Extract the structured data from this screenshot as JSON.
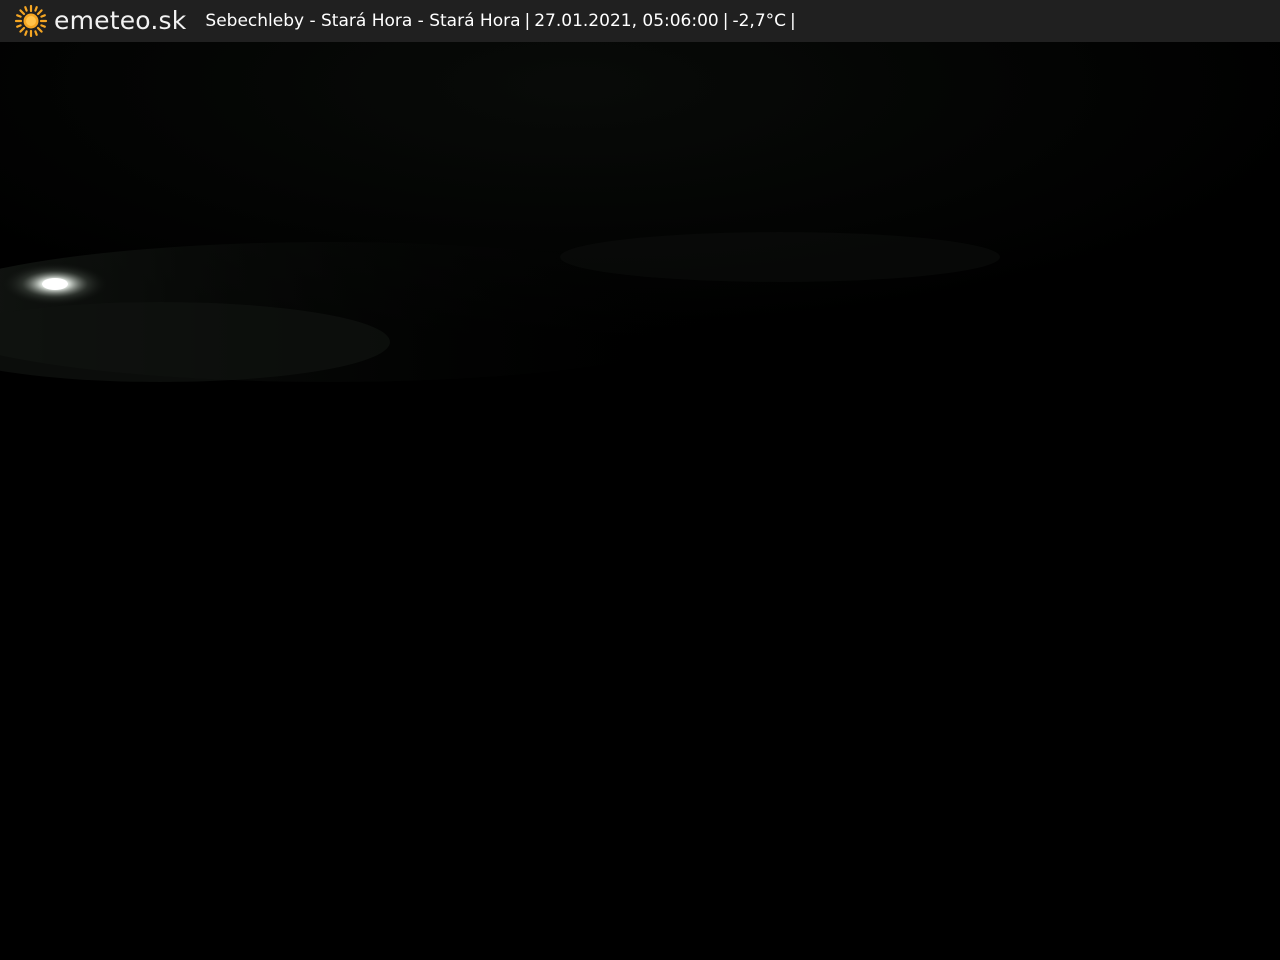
{
  "header": {
    "brand": "emeteo.sk",
    "location": "Sebechleby - Stará Hora - Stará Hora",
    "datetime": "27.01.2021, 05:06:00",
    "temperature": "-2,7°C",
    "separator": "|",
    "logo_icon": "sun-icon"
  },
  "colors": {
    "bar_background": "#202020",
    "sun": "#f5a623",
    "scene_background": "#000000"
  }
}
